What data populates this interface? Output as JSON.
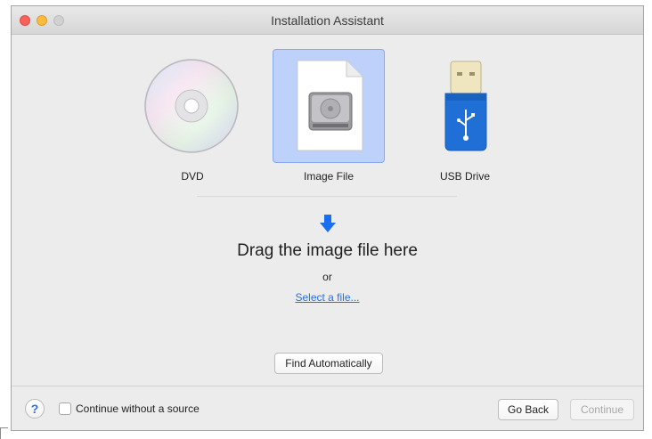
{
  "window": {
    "title": "Installation Assistant"
  },
  "sources": {
    "dvd": {
      "label": "DVD"
    },
    "image_file": {
      "label": "Image File"
    },
    "usb_drive": {
      "label": "USB Drive"
    }
  },
  "drop_zone": {
    "heading": "Drag the image file here",
    "or_text": "or",
    "select_link": "Select a file..."
  },
  "actions": {
    "find_automatically": "Find Automatically"
  },
  "footer": {
    "help_label": "?",
    "continue_without_source": "Continue without a source",
    "continue_without_source_checked": false,
    "go_back": "Go Back",
    "continue": "Continue",
    "continue_enabled": false
  },
  "colors": {
    "selection_bg": "#bdd1fa",
    "accent": "#2c6fd8",
    "arrow": "#1a6ff0",
    "usb_body": "#1f6fd6"
  },
  "icons": [
    "dvd-disc-icon",
    "hard-drive-document-icon",
    "usb-drive-icon",
    "down-arrow-icon",
    "help-icon",
    "checkbox"
  ]
}
